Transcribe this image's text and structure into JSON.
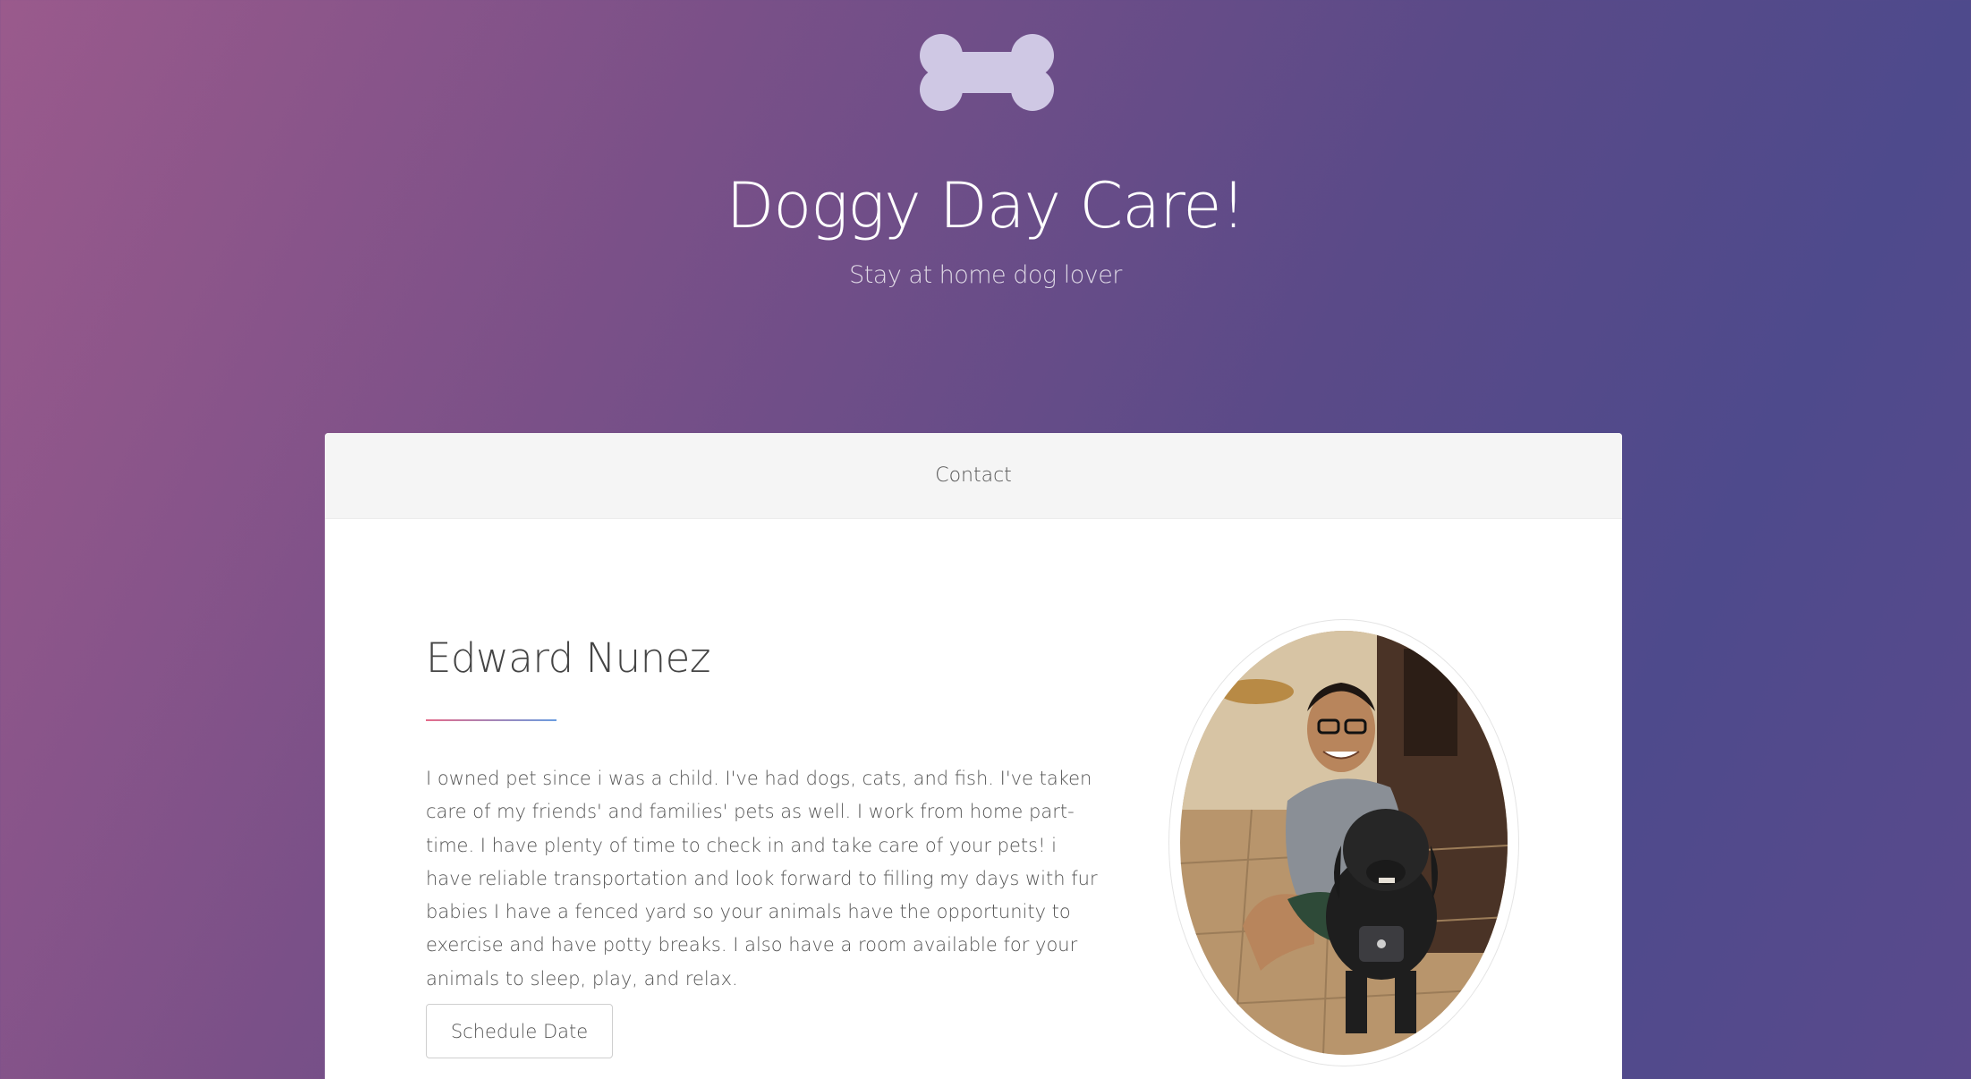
{
  "header": {
    "logo_icon": "dog-bone-icon",
    "title": "Doggy Day Care!",
    "subtitle": "Stay at home dog lover"
  },
  "nav": {
    "items": [
      {
        "label": "Contact"
      }
    ]
  },
  "profile": {
    "name": "Edward Nunez",
    "bio": "I owned pet since i was a child. I've had dogs, cats, and fish. I've taken care of my friends' and families' pets as well. I work from home part-time. I have plenty of time to check in and take care of your pets! i have reliable transportation and look forward to filling my days with fur babies I have a fenced yard so your animals have the opportunity to exercise and have potty breaks. I also have a room available for your animals to sleep, play, and relax.",
    "button_label": "Schedule Date",
    "photo_icon": "profile-photo"
  },
  "colors": {
    "accent_start": "#e56b8a",
    "accent_end": "#6a9de0",
    "logo": "#cfc8e4"
  }
}
